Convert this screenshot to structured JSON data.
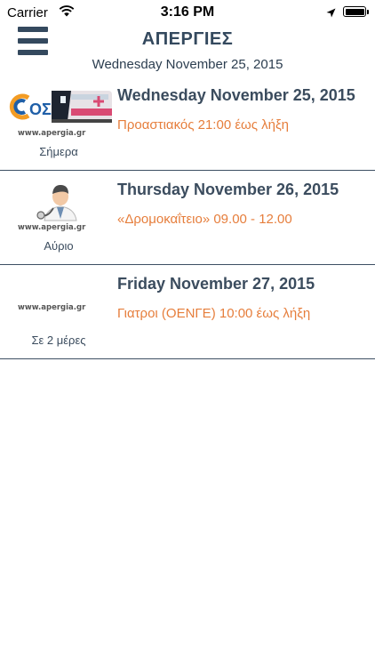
{
  "status_bar": {
    "carrier": "Carrier",
    "time": "3:16 PM"
  },
  "nav": {
    "title": "ΑΠΕΡΓΙΕΣ",
    "subtitle": "Wednesday November 25, 2015"
  },
  "items": [
    {
      "date": "Wednesday November 25, 2015",
      "desc": "Προαστιακός 21:00 έως λήξη",
      "relative_day": "Σήμερα",
      "watermark": "www.apergia.gr",
      "logo_text": "OΣE",
      "icon": "train-icon"
    },
    {
      "date": "Thursday November 26, 2015",
      "desc": "«Δρομοκαΐτειο» 09.00 - 12.00",
      "relative_day": "Αύριο",
      "watermark": "www.apergia.gr",
      "icon": "doctor-icon"
    },
    {
      "date": "Friday November 27, 2015",
      "desc": "Γιατροι (ΟΕΝΓΕ) 10:00 έως λήξη",
      "relative_day": "Σε 2 μέρες",
      "watermark": "www.apergia.gr",
      "icon": "watermark-logo"
    }
  ],
  "colors": {
    "nav": "#34495e",
    "accent": "#e67e3c",
    "divider": "#3d4f63"
  }
}
